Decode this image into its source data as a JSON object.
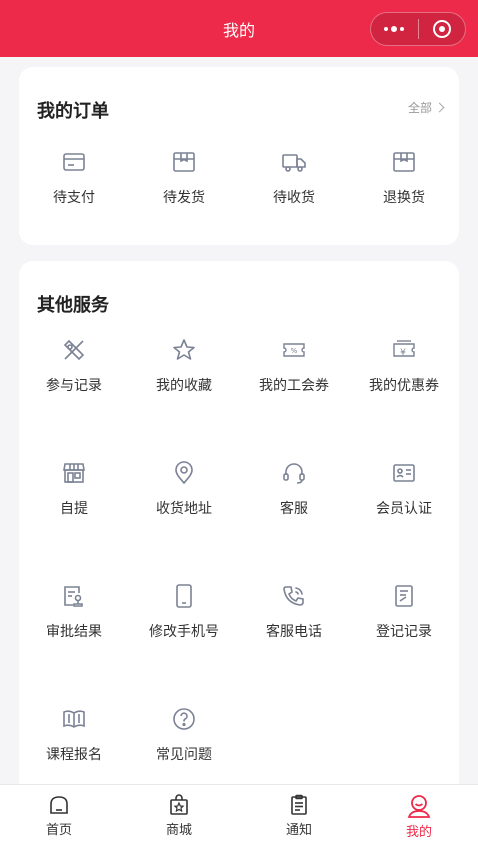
{
  "header": {
    "title": "我的",
    "menu_icon": "more-dots-icon",
    "close_icon": "target-circle-icon"
  },
  "orders": {
    "title": "我的订单",
    "all_label": "全部",
    "items": [
      {
        "label": "待支付",
        "icon": "card-icon"
      },
      {
        "label": "待发货",
        "icon": "box-icon"
      },
      {
        "label": "待收货",
        "icon": "truck-icon"
      },
      {
        "label": "退换货",
        "icon": "box-return-icon"
      }
    ]
  },
  "services": {
    "title": "其他服务",
    "items": [
      {
        "label": "参与记录",
        "icon": "ticket-off-icon"
      },
      {
        "label": "我的收藏",
        "icon": "star-icon"
      },
      {
        "label": "我的工会券",
        "icon": "discount-coupon-icon"
      },
      {
        "label": "我的优惠券",
        "icon": "yen-coupon-icon"
      },
      {
        "label": "自提",
        "icon": "store-icon"
      },
      {
        "label": "收货地址",
        "icon": "location-icon"
      },
      {
        "label": "客服",
        "icon": "headset-icon"
      },
      {
        "label": "会员认证",
        "icon": "id-card-icon"
      },
      {
        "label": "审批结果",
        "icon": "approval-icon"
      },
      {
        "label": "修改手机号",
        "icon": "phone-icon"
      },
      {
        "label": "客服电话",
        "icon": "phone-call-icon"
      },
      {
        "label": "登记记录",
        "icon": "record-icon"
      },
      {
        "label": "课程报名",
        "icon": "book-icon"
      },
      {
        "label": "常见问题",
        "icon": "question-icon"
      }
    ]
  },
  "tabbar": {
    "items": [
      {
        "label": "首页",
        "icon": "home-icon"
      },
      {
        "label": "商城",
        "icon": "shop-bag-icon"
      },
      {
        "label": "通知",
        "icon": "notice-icon"
      },
      {
        "label": "我的",
        "icon": "profile-icon",
        "active": true
      }
    ]
  },
  "colors": {
    "brand": "#ee2a4a",
    "icon": "#7b8294",
    "background": "#f5f5f7"
  }
}
